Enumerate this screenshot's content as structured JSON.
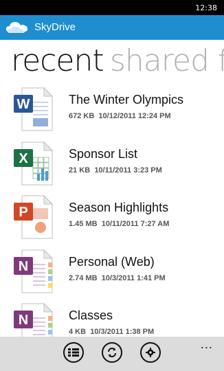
{
  "status": {
    "time": "12:38"
  },
  "app": {
    "title": "SkyDrive"
  },
  "pivot": {
    "active": "recent",
    "next": "shared f"
  },
  "items": [
    {
      "name": "The Winter Olympics",
      "size": "672 KB",
      "date": "10/12/2011 12:24 PM",
      "type": "word",
      "type_letter": "W",
      "color": "#2b5797"
    },
    {
      "name": "Sponsor List",
      "size": "21 KB",
      "date": "10/11/2011 3:23 PM",
      "type": "excel",
      "type_letter": "X",
      "color": "#1e7145"
    },
    {
      "name": "Season Highlights",
      "size": "1.45 MB",
      "date": "10/11/2011 7:27 AM",
      "type": "powerpoint",
      "type_letter": "P",
      "color": "#d24726"
    },
    {
      "name": "Personal (Web)",
      "size": "2.74 MB",
      "date": "10/3/2011 1:41 PM",
      "type": "onenote",
      "type_letter": "N",
      "color": "#80397b"
    },
    {
      "name": "Classes",
      "size": "4 KB",
      "date": "10/3/2011 1:38 PM",
      "type": "onenote",
      "type_letter": "N",
      "color": "#80397b"
    }
  ],
  "appbar": {
    "buttons": [
      "list-icon",
      "sync-icon",
      "settings-icon"
    ],
    "more": "..."
  },
  "colors": {
    "accent": "#1e8ed0",
    "appbar_bg": "#dcdcdc"
  }
}
